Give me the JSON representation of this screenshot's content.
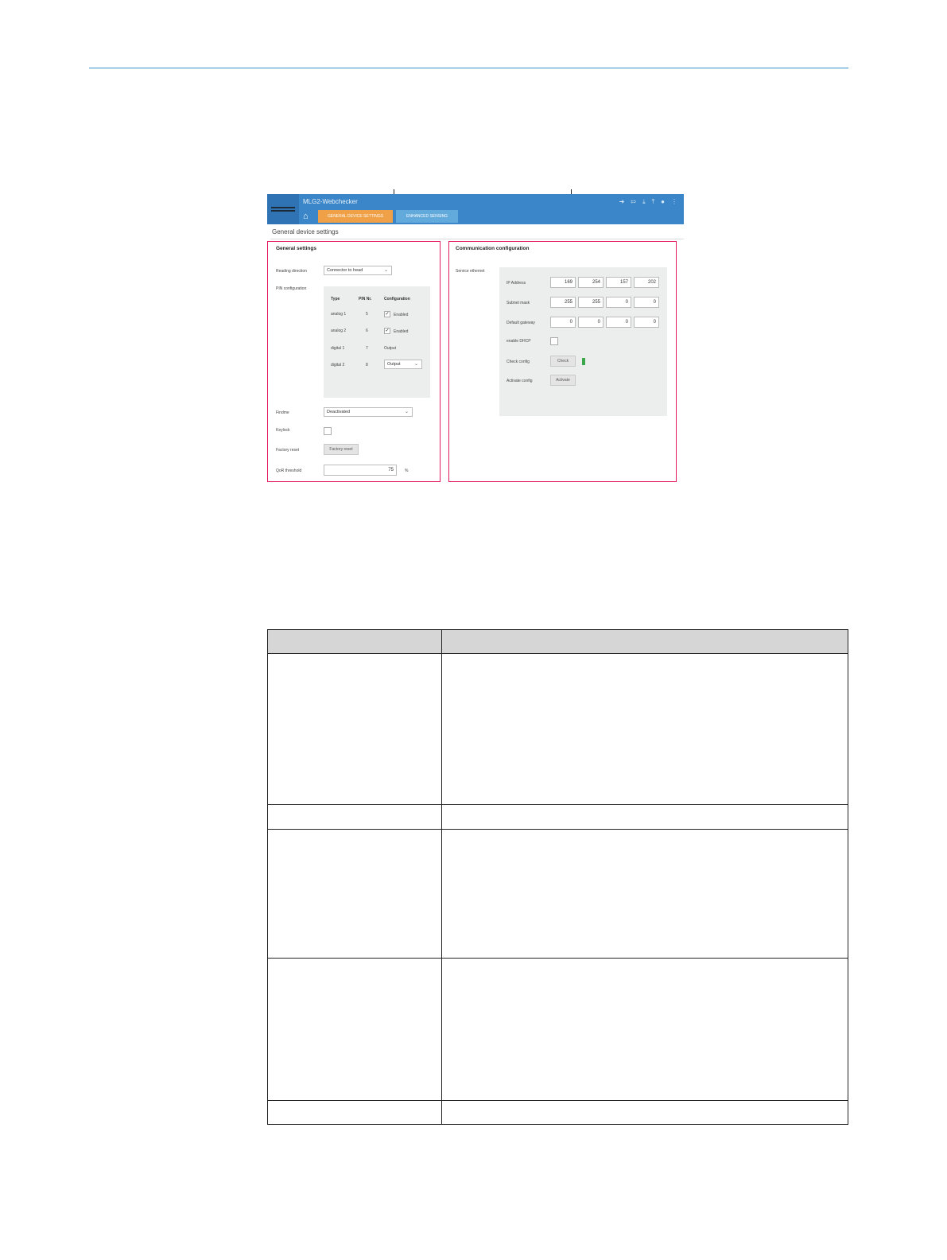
{
  "app": {
    "title": "MLG2-Webchecker",
    "home_icon": "home-icon",
    "tabs": [
      {
        "label": "GENERAL DEVICE SETTINGS",
        "active": true
      },
      {
        "label": "ENHANCED SENSING",
        "active": false
      }
    ],
    "toolbar_icons": [
      "login-icon",
      "logout-icon",
      "download-icon",
      "upload-icon",
      "info-icon",
      "more-icon"
    ],
    "page_heading": "General device settings"
  },
  "general": {
    "title": "General settings",
    "reading_direction": {
      "label": "Reading direction",
      "value": "Connector to head"
    },
    "pin_config": {
      "label": "PIN configuration",
      "headers": [
        "Type",
        "PIN Nr.",
        "Configuration"
      ],
      "rows": [
        {
          "type": "analog 1",
          "pin": "5",
          "config": "Enabled",
          "checked": true
        },
        {
          "type": "analog 2",
          "pin": "6",
          "config": "Enabled",
          "checked": true
        },
        {
          "type": "digital 1",
          "pin": "7",
          "config": "Output"
        },
        {
          "type": "digital 2",
          "pin": "8",
          "config": "Output",
          "dropdown": true
        }
      ]
    },
    "findme": {
      "label": "Findme",
      "value": "Deactivated"
    },
    "keylock": {
      "label": "Keylock",
      "checked": false
    },
    "factory_reset": {
      "label": "Factory reset",
      "button": "Factory reset"
    },
    "qoR": {
      "label": "QoR threshold",
      "value": "75",
      "unit": "%"
    }
  },
  "comm": {
    "title": "Communication configuration",
    "service": "Service ethernet",
    "ip": {
      "label": "IP Address",
      "octets": [
        "169",
        "254",
        "157",
        "202"
      ]
    },
    "subnet": {
      "label": "Subnet mask",
      "octets": [
        "255",
        "255",
        "0",
        "0"
      ]
    },
    "gateway": {
      "label": "Default gateway",
      "octets": [
        "0",
        "0",
        "0",
        "0"
      ]
    },
    "dhcp": {
      "label": "enable DHCP",
      "checked": false
    },
    "check": {
      "label": "Check config",
      "button": "Check",
      "status_color": "#3aa84a"
    },
    "activate": {
      "label": "Activate config",
      "button": "Activate"
    }
  },
  "colors": {
    "accent_rule": "#3a8fd0",
    "highlight_frame": "#e2185a",
    "topbar": "#3b86c8",
    "active_tab": "#f0a046"
  }
}
